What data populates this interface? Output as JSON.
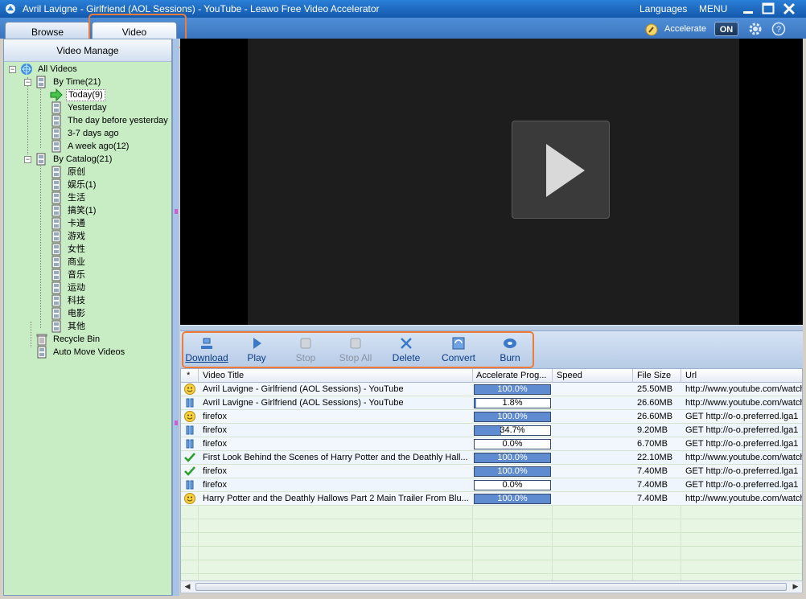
{
  "window": {
    "title": "Avril Lavigne - Girlfriend (AOL Sessions) - YouTube - Leawo Free Video Accelerator",
    "languages_label": "Languages",
    "menu_label": "MENU"
  },
  "tabs": [
    {
      "label": "Browse"
    },
    {
      "label": "Video"
    }
  ],
  "header": {
    "accelerate_label": "Accelerate",
    "toggle_label": "ON"
  },
  "sidebar": {
    "title": "Video Manage",
    "tree": [
      {
        "label": "All Videos"
      },
      {
        "label": "By Time(21)"
      },
      {
        "label": "Today(9)"
      },
      {
        "label": "Yesterday"
      },
      {
        "label": "The day before yesterday"
      },
      {
        "label": "3-7 days ago"
      },
      {
        "label": "A week ago(12)"
      },
      {
        "label": "By Catalog(21)"
      },
      {
        "label": "原创"
      },
      {
        "label": "娱乐(1)"
      },
      {
        "label": "生活"
      },
      {
        "label": "搞笑(1)"
      },
      {
        "label": "卡通"
      },
      {
        "label": "游戏"
      },
      {
        "label": "女性"
      },
      {
        "label": "商业"
      },
      {
        "label": "音乐"
      },
      {
        "label": "运动"
      },
      {
        "label": "科技"
      },
      {
        "label": "电影"
      },
      {
        "label": "其他"
      },
      {
        "label": "Recycle Bin"
      },
      {
        "label": "Auto Move Videos"
      }
    ]
  },
  "toolbar": {
    "download": "Download",
    "play": "Play",
    "stop": "Stop",
    "stop_all": "Stop All",
    "delete": "Delete",
    "convert": "Convert",
    "burn": "Burn"
  },
  "table": {
    "headers": {
      "star": "*",
      "title": "Video Title",
      "progress": "Accelerate Prog...",
      "speed": "Speed",
      "size": "File Size",
      "url": "Url"
    },
    "rows": [
      {
        "status": "downloading",
        "title": "Avril Lavigne - Girlfriend (AOL Sessions) - YouTube",
        "progress_text": "100.0%",
        "progress": 1.0,
        "size": "25.50MB",
        "url": "http://www.youtube.com/watch"
      },
      {
        "status": "paused",
        "title": "Avril Lavigne - Girlfriend (AOL Sessions) - YouTube",
        "progress_text": "1.8%",
        "progress": 0.018,
        "size": "26.60MB",
        "url": "http://www.youtube.com/watch"
      },
      {
        "status": "downloading",
        "title": "firefox",
        "progress_text": "100.0%",
        "progress": 1.0,
        "size": "26.60MB",
        "url": "GET http://o-o.preferred.lga1"
      },
      {
        "status": "paused",
        "title": "firefox",
        "progress_text": "34.7%",
        "progress": 0.347,
        "size": "9.20MB",
        "url": "GET http://o-o.preferred.lga1"
      },
      {
        "status": "paused",
        "title": "firefox",
        "progress_text": "0.0%",
        "progress": 0.0,
        "size": "6.70MB",
        "url": "GET http://o-o.preferred.lga1"
      },
      {
        "status": "done",
        "title": "First Look Behind the Scenes of Harry Potter and the Deathly Hall...",
        "progress_text": "100.0%",
        "progress": 1.0,
        "size": "22.10MB",
        "url": "http://www.youtube.com/watch"
      },
      {
        "status": "done",
        "title": "firefox",
        "progress_text": "100.0%",
        "progress": 1.0,
        "size": "7.40MB",
        "url": "GET http://o-o.preferred.lga1"
      },
      {
        "status": "paused",
        "title": "firefox",
        "progress_text": "0.0%",
        "progress": 0.0,
        "size": "7.40MB",
        "url": "GET http://o-o.preferred.lga1"
      },
      {
        "status": "downloading",
        "title": "Harry Potter and the Deathly Hallows Part 2 Main Trailer From Blu...",
        "progress_text": "100.0%",
        "progress": 1.0,
        "size": "7.40MB",
        "url": "http://www.youtube.com/watch"
      }
    ]
  },
  "colors": {
    "titlebar": "#1d66c0",
    "sidebar_bg": "#c8ecc4",
    "highlight": "#f07a36",
    "progress_fill": "#5f8bd0"
  }
}
